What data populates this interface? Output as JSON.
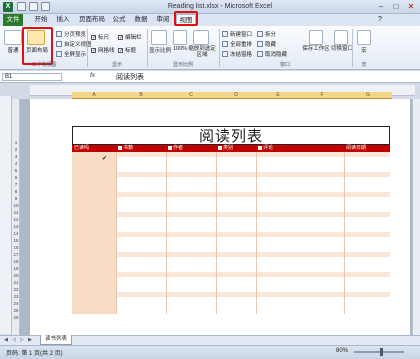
{
  "window": {
    "title": "Reading list.xlsx - Microsoft Excel"
  },
  "tabs": {
    "file": "文件",
    "items": [
      "开始",
      "插入",
      "页面布局",
      "公式",
      "数据",
      "审阅",
      "视图"
    ],
    "active": "视图"
  },
  "ribbon": {
    "workbook_views": {
      "normal": "普通",
      "page_layout": "页面布局",
      "page_break": "分页预览",
      "custom_views": "自定义视图",
      "full_screen": "全屏显示",
      "group_label": "工作簿视图"
    },
    "show": {
      "ruler": "标尺",
      "formula_bar": "编辑栏",
      "gridlines": "网格线",
      "headings": "标题",
      "group_label": "显示"
    },
    "zoom": {
      "zoom": "显示比例",
      "hundred": "100%",
      "zoom_to_selection": "缩放到选定区域",
      "group_label": "显示比例"
    },
    "window": {
      "new_window": "新建窗口",
      "arrange_all": "全部重排",
      "freeze_panes": "冻结窗格",
      "split": "拆分",
      "hide": "隐藏",
      "unhide": "取消隐藏",
      "save_workspace": "保存工作区",
      "switch_windows": "切换窗口",
      "group_label": "窗口"
    },
    "macros": {
      "macros": "宏",
      "group_label": "宏"
    }
  },
  "formula_bar": {
    "name_box": "B1",
    "fx": "fx",
    "value": "阅读列表"
  },
  "sheet": {
    "columns": [
      "A",
      "B",
      "C",
      "D",
      "E",
      "F",
      "G"
    ],
    "rows": [
      "1",
      "2",
      "3",
      "4",
      "5",
      "6",
      "7",
      "8",
      "9",
      "10",
      "11",
      "12",
      "13",
      "14",
      "15",
      "16",
      "17",
      "18",
      "19",
      "20",
      "21",
      "22",
      "23",
      "24",
      "25",
      "26"
    ],
    "table_title": "阅读列表",
    "table_headers": [
      "已读吗",
      "书籍",
      "作者",
      "类别",
      "评论",
      "阅读日期"
    ]
  },
  "sheet_tabs": {
    "active": "读书列表"
  },
  "status": {
    "page": "页码: 第 1 页(共 2 页)",
    "zoom": "80%"
  },
  "colors": {
    "accent_red": "#c00000",
    "highlight": "#e01010",
    "band": "#fbe7d8"
  }
}
